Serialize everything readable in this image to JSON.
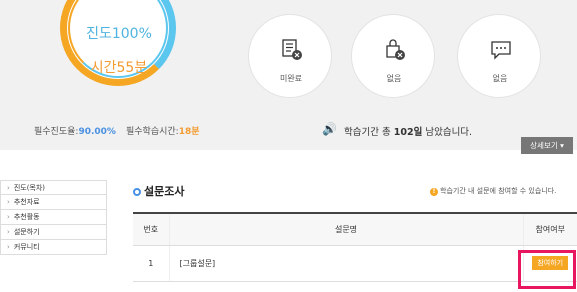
{
  "progress": {
    "percent_label": "진도100%",
    "time_label": "시간55분"
  },
  "status_circles": [
    {
      "icon": "checklist-x-icon",
      "label": "미완료"
    },
    {
      "icon": "bag-x-icon",
      "label": "없음"
    },
    {
      "icon": "chat-bubble-icon",
      "label": "없음"
    }
  ],
  "summary": {
    "req_progress_label": "필수진도율:",
    "req_progress_value": "90.00%",
    "req_time_label": "필수학습시간:",
    "req_time_value": "18분",
    "remain_prefix": "학습기간 총 ",
    "remain_days": "102일",
    "remain_suffix": " 남았습니다."
  },
  "detail_button": "상세보기 ▾",
  "side_nav": [
    "진도(목차)",
    "추천자료",
    "추천활동",
    "설문하기",
    "커뮤니티"
  ],
  "section": {
    "title": "설문조사",
    "notice": "학습기간 내 설문에 참여할 수 있습니다."
  },
  "table": {
    "headers": [
      "번호",
      "설문명",
      "참여여부"
    ],
    "rows": [
      {
        "num": "1",
        "name": "[그룹설문]",
        "action": "참여하기"
      }
    ]
  },
  "colors": {
    "accent_orange": "#f5a623",
    "accent_blue": "#5bc6ee",
    "highlight": "#e8165e"
  }
}
